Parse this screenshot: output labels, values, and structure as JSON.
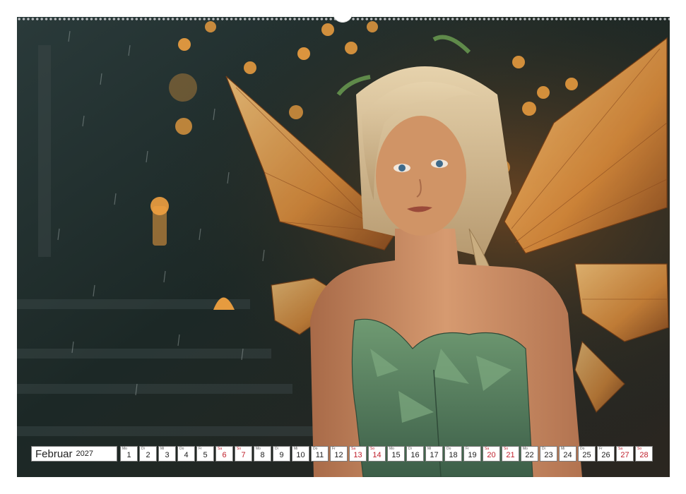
{
  "calendar": {
    "month": "Februar",
    "year": "2027",
    "weekend_color": "#c0202c",
    "days": [
      {
        "dow": "Mo",
        "num": "1",
        "weekend": false
      },
      {
        "dow": "Di",
        "num": "2",
        "weekend": false
      },
      {
        "dow": "Mi",
        "num": "3",
        "weekend": false
      },
      {
        "dow": "Do",
        "num": "4",
        "weekend": false
      },
      {
        "dow": "Fr",
        "num": "5",
        "weekend": false
      },
      {
        "dow": "Sa",
        "num": "6",
        "weekend": true
      },
      {
        "dow": "So",
        "num": "7",
        "weekend": true
      },
      {
        "dow": "Mo",
        "num": "8",
        "weekend": false
      },
      {
        "dow": "Di",
        "num": "9",
        "weekend": false
      },
      {
        "dow": "Mi",
        "num": "10",
        "weekend": false
      },
      {
        "dow": "Do",
        "num": "11",
        "weekend": false
      },
      {
        "dow": "Fr",
        "num": "12",
        "weekend": false
      },
      {
        "dow": "Sa",
        "num": "13",
        "weekend": true
      },
      {
        "dow": "So",
        "num": "14",
        "weekend": true
      },
      {
        "dow": "Mo",
        "num": "15",
        "weekend": false
      },
      {
        "dow": "Di",
        "num": "16",
        "weekend": false
      },
      {
        "dow": "Mi",
        "num": "17",
        "weekend": false
      },
      {
        "dow": "Do",
        "num": "18",
        "weekend": false
      },
      {
        "dow": "Fr",
        "num": "19",
        "weekend": false
      },
      {
        "dow": "Sa",
        "num": "20",
        "weekend": true
      },
      {
        "dow": "So",
        "num": "21",
        "weekend": true
      },
      {
        "dow": "Mo",
        "num": "22",
        "weekend": false
      },
      {
        "dow": "Di",
        "num": "23",
        "weekend": false
      },
      {
        "dow": "Mi",
        "num": "24",
        "weekend": false
      },
      {
        "dow": "Do",
        "num": "25",
        "weekend": false
      },
      {
        "dow": "Fr",
        "num": "26",
        "weekend": false
      },
      {
        "dow": "Sa",
        "num": "27",
        "weekend": true
      },
      {
        "dow": "So",
        "num": "28",
        "weekend": true
      }
    ]
  },
  "photo": {
    "subject": "fairy-illustration",
    "palette": {
      "background_dark": "#1f2b2a",
      "wing_glow": "#e8a24a",
      "dress_green": "#4f7a5a",
      "hair_blonde": "#d9c29a",
      "skin": "#c98a62",
      "bokeh_orange": "#f0a040"
    }
  }
}
